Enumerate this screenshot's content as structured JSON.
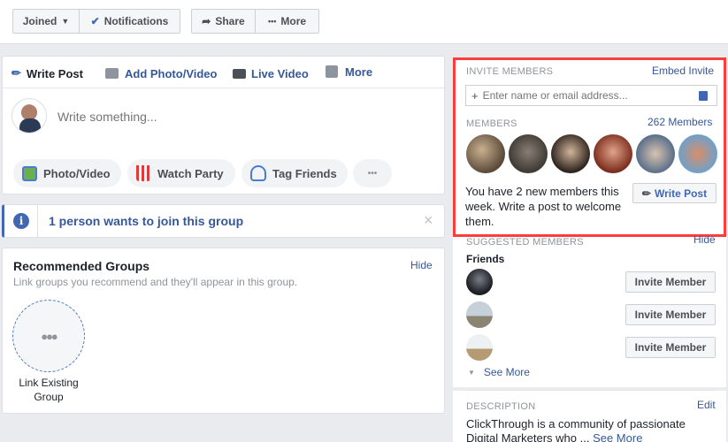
{
  "top_actions": {
    "joined": "Joined",
    "notifications": "Notifications",
    "share": "Share",
    "more": "More"
  },
  "composer": {
    "tabs": [
      "Write Post",
      "Add Photo/Video",
      "Live Video",
      "More"
    ],
    "placeholder": "Write something...",
    "actions": [
      "Photo/Video",
      "Watch Party",
      "Tag Friends"
    ],
    "overflow": "•••"
  },
  "join_banner": {
    "text": "1 person wants to join this group",
    "close": "×"
  },
  "recommended": {
    "title": "Recommended Groups",
    "hide": "Hide",
    "subtitle": "Link groups you recommend and they'll appear in this group.",
    "link_label": "Link Existing Group"
  },
  "invite": {
    "title": "INVITE MEMBERS",
    "embed": "Embed Invite",
    "placeholder": "Enter name or email address...",
    "members_label": "MEMBERS",
    "members_count": "262 Members",
    "new_members_text": "You have 2 new members this week. Write a post to welcome them.",
    "write_post": "Write Post"
  },
  "suggested": {
    "title": "SUGGESTED MEMBERS",
    "hide": "Hide",
    "friends_label": "Friends",
    "invite_label": "Invite Member",
    "see_more": "See More"
  },
  "description": {
    "title": "DESCRIPTION",
    "edit": "Edit",
    "text": "ClickThrough is a community of passionate Digital Marketers who ...",
    "see_more": "See More"
  },
  "colors": {
    "accent": "#365899",
    "highlight": "#fa3e3e",
    "banner_blue": "#4267b2"
  }
}
